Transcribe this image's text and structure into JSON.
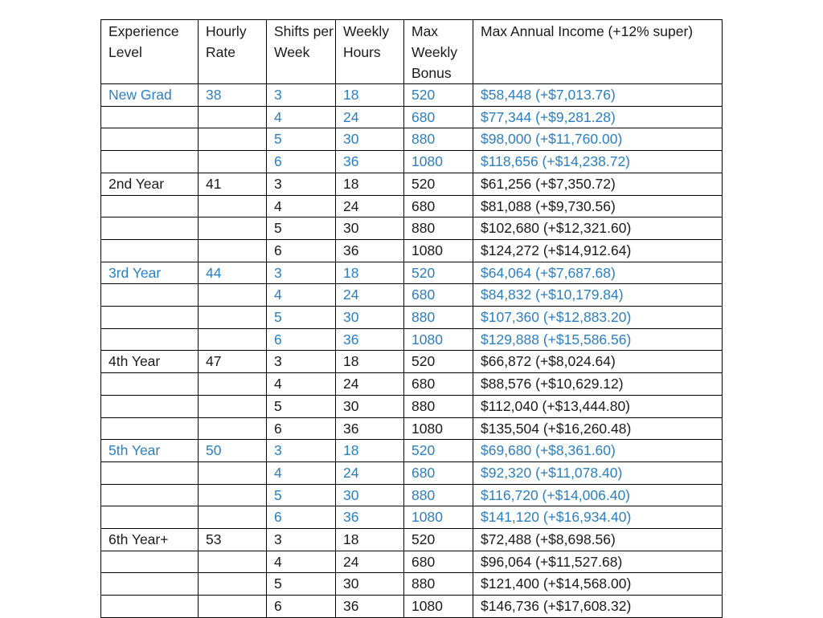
{
  "table": {
    "headers": [
      "Experience Level",
      "Hourly Rate",
      "Shifts per Week",
      "Weekly Hours",
      "Max Weekly Bonus",
      "Max Annual Income (+12% super)"
    ],
    "highlight_color": "#2a7fc1",
    "text_color": "#1a1a1a",
    "rows": [
      {
        "level": "New Grad",
        "rate": "38",
        "shifts": "3",
        "hours": "18",
        "bonus": "520",
        "income": "$58,448 (+$7,013.76)",
        "highlight": true
      },
      {
        "level": "",
        "rate": "",
        "shifts": "4",
        "hours": "24",
        "bonus": "680",
        "income": "$77,344 (+$9,281.28)",
        "highlight": true
      },
      {
        "level": "",
        "rate": "",
        "shifts": "5",
        "hours": "30",
        "bonus": "880",
        "income": "$98,000 (+$11,760.00)",
        "highlight": true
      },
      {
        "level": "",
        "rate": "",
        "shifts": "6",
        "hours": "36",
        "bonus": "1080",
        "income": "$118,656 (+$14,238.72)",
        "highlight": true
      },
      {
        "level": "2nd Year",
        "rate": "41",
        "shifts": "3",
        "hours": "18",
        "bonus": "520",
        "income": "$61,256 (+$7,350.72)",
        "highlight": false
      },
      {
        "level": "",
        "rate": "",
        "shifts": "4",
        "hours": "24",
        "bonus": "680",
        "income": "$81,088 (+$9,730.56)",
        "highlight": false
      },
      {
        "level": "",
        "rate": "",
        "shifts": "5",
        "hours": "30",
        "bonus": "880",
        "income": "$102,680 (+$12,321.60)",
        "highlight": false
      },
      {
        "level": "",
        "rate": "",
        "shifts": "6",
        "hours": "36",
        "bonus": "1080",
        "income": "$124,272 (+$14,912.64)",
        "highlight": false
      },
      {
        "level": "3rd Year",
        "rate": "44",
        "shifts": "3",
        "hours": "18",
        "bonus": "520",
        "income": "$64,064 (+$7,687.68)",
        "highlight": true
      },
      {
        "level": "",
        "rate": "",
        "shifts": "4",
        "hours": "24",
        "bonus": "680",
        "income": "$84,832 (+$10,179.84)",
        "highlight": true
      },
      {
        "level": "",
        "rate": "",
        "shifts": "5",
        "hours": "30",
        "bonus": "880",
        "income": "$107,360 (+$12,883.20)",
        "highlight": true
      },
      {
        "level": "",
        "rate": "",
        "shifts": "6",
        "hours": "36",
        "bonus": "1080",
        "income": "$129,888 (+$15,586.56)",
        "highlight": true
      },
      {
        "level": "4th Year",
        "rate": "47",
        "shifts": "3",
        "hours": "18",
        "bonus": "520",
        "income": "$66,872 (+$8,024.64)",
        "highlight": false
      },
      {
        "level": "",
        "rate": "",
        "shifts": "4",
        "hours": "24",
        "bonus": "680",
        "income": "$88,576 (+$10,629.12)",
        "highlight": false
      },
      {
        "level": "",
        "rate": "",
        "shifts": "5",
        "hours": "30",
        "bonus": "880",
        "income": "$112,040 (+$13,444.80)",
        "highlight": false
      },
      {
        "level": "",
        "rate": "",
        "shifts": "6",
        "hours": "36",
        "bonus": "1080",
        "income": "$135,504 (+$16,260.48)",
        "highlight": false
      },
      {
        "level": "5th Year",
        "rate": "50",
        "shifts": "3",
        "hours": "18",
        "bonus": "520",
        "income": "$69,680 (+$8,361.60)",
        "highlight": true
      },
      {
        "level": "",
        "rate": "",
        "shifts": "4",
        "hours": "24",
        "bonus": "680",
        "income": "$92,320 (+$11,078.40)",
        "highlight": true
      },
      {
        "level": "",
        "rate": "",
        "shifts": "5",
        "hours": "30",
        "bonus": "880",
        "income": "$116,720 (+$14,006.40)",
        "highlight": true
      },
      {
        "level": "",
        "rate": "",
        "shifts": "6",
        "hours": "36",
        "bonus": "1080",
        "income": "$141,120 (+$16,934.40)",
        "highlight": true
      },
      {
        "level": "6th Year+",
        "rate": "53",
        "shifts": "3",
        "hours": "18",
        "bonus": "520",
        "income": "$72,488 (+$8,698.56)",
        "highlight": false
      },
      {
        "level": "",
        "rate": "",
        "shifts": "4",
        "hours": "24",
        "bonus": "680",
        "income": "$96,064 (+$11,527.68)",
        "highlight": false
      },
      {
        "level": "",
        "rate": "",
        "shifts": "5",
        "hours": "30",
        "bonus": "880",
        "income": "$121,400 (+$14,568.00)",
        "highlight": false
      },
      {
        "level": "",
        "rate": "",
        "shifts": "6",
        "hours": "36",
        "bonus": "1080",
        "income": "$146,736 (+$17,608.32)",
        "highlight": false
      }
    ]
  }
}
